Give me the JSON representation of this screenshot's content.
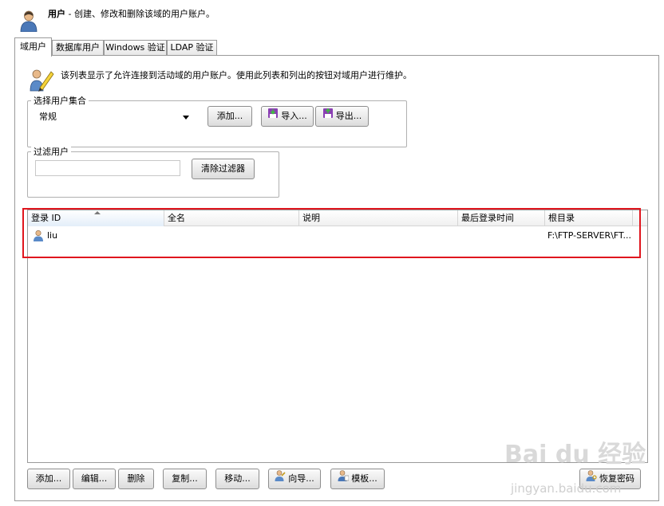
{
  "header": {
    "title": "用户",
    "subtitle": " - 创建、修改和删除该域的用户账户。"
  },
  "tabs": [
    {
      "label": "域用户",
      "active": true
    },
    {
      "label": "数据库用户",
      "active": false
    },
    {
      "label": "Windows 验证",
      "active": false
    },
    {
      "label": "LDAP 验证",
      "active": false
    }
  ],
  "description": "该列表显示了允许连接到活动域的用户账户。使用此列表和列出的按钮对域用户进行维护。",
  "user_set": {
    "legend": "选择用户集合",
    "selected": "常规",
    "add_label": "添加...",
    "import_label": "导入...",
    "export_label": "导出..."
  },
  "filter": {
    "legend": "过滤用户",
    "value": "",
    "clear_label": "清除过滤器"
  },
  "table": {
    "columns": [
      "登录 ID",
      "全名",
      "说明",
      "最后登录时间",
      "根目录"
    ],
    "rows": [
      {
        "login_id": "liu",
        "full_name": "",
        "description": "",
        "last_login": "",
        "root_dir": "F:\\FTP-SERVER\\FT..."
      }
    ]
  },
  "bottom_buttons": {
    "add": "添加...",
    "edit": "编辑...",
    "delete": "删除",
    "copy": "复制...",
    "move": "移动...",
    "wizard": "向导...",
    "template": "模板...",
    "recover": "恢复密码"
  },
  "watermark": {
    "brand": "Bai du 经验",
    "url": "jingyan.baidu.com"
  },
  "colors": {
    "highlight": "#e0161e",
    "import_icon": "#8a3fb3"
  }
}
